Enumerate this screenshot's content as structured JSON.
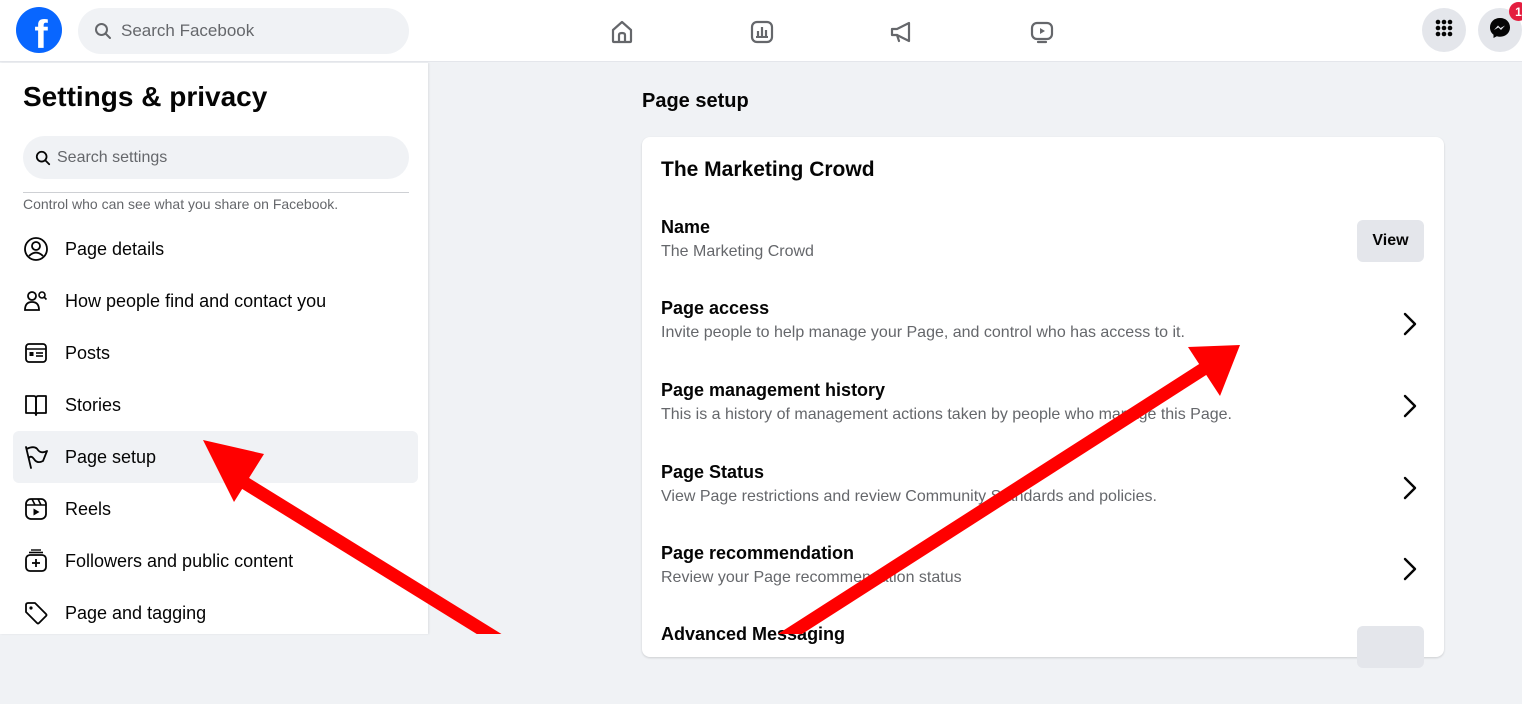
{
  "topbar": {
    "search_placeholder": "Search Facebook",
    "nav_icons": [
      "home-icon",
      "insights-icon",
      "megaphone-icon",
      "video-icon"
    ],
    "menu_icon": "grid-menu-icon",
    "messenger_icon": "messenger-icon",
    "messenger_badge": "1",
    "brand_color": "#0866ff"
  },
  "sidebar": {
    "title": "Settings & privacy",
    "search_placeholder": "Search settings",
    "description": "Control who can see what you share on Facebook.",
    "items": [
      {
        "label": "Page details",
        "icon": "person-circle-icon"
      },
      {
        "label": "How people find and contact you",
        "icon": "people-search-icon"
      },
      {
        "label": "Posts",
        "icon": "post-icon"
      },
      {
        "label": "Stories",
        "icon": "book-icon"
      },
      {
        "label": "Page setup",
        "icon": "flag-icon",
        "active": true
      },
      {
        "label": "Reels",
        "icon": "reels-icon"
      },
      {
        "label": "Followers and public content",
        "icon": "followers-icon"
      },
      {
        "label": "Page and tagging",
        "icon": "tag-icon"
      }
    ]
  },
  "main": {
    "title": "Page setup",
    "card": {
      "title": "The Marketing Crowd",
      "rows": [
        {
          "title": "Name",
          "subtitle": "The Marketing Crowd",
          "action": "View"
        },
        {
          "title": "Page access",
          "subtitle": "Invite people to help manage your Page, and control who has access to it."
        },
        {
          "title": "Page management history",
          "subtitle": "This is a history of management actions taken by people who manage this Page."
        },
        {
          "title": "Page Status",
          "subtitle": "View Page restrictions and review Community Standards and policies."
        },
        {
          "title": "Page recommendation",
          "subtitle": "Review your Page recommendation status"
        },
        {
          "title": "Advanced Messaging",
          "subtitle": ""
        }
      ]
    }
  },
  "overlay": {
    "arrow_color": "#ff0000"
  }
}
